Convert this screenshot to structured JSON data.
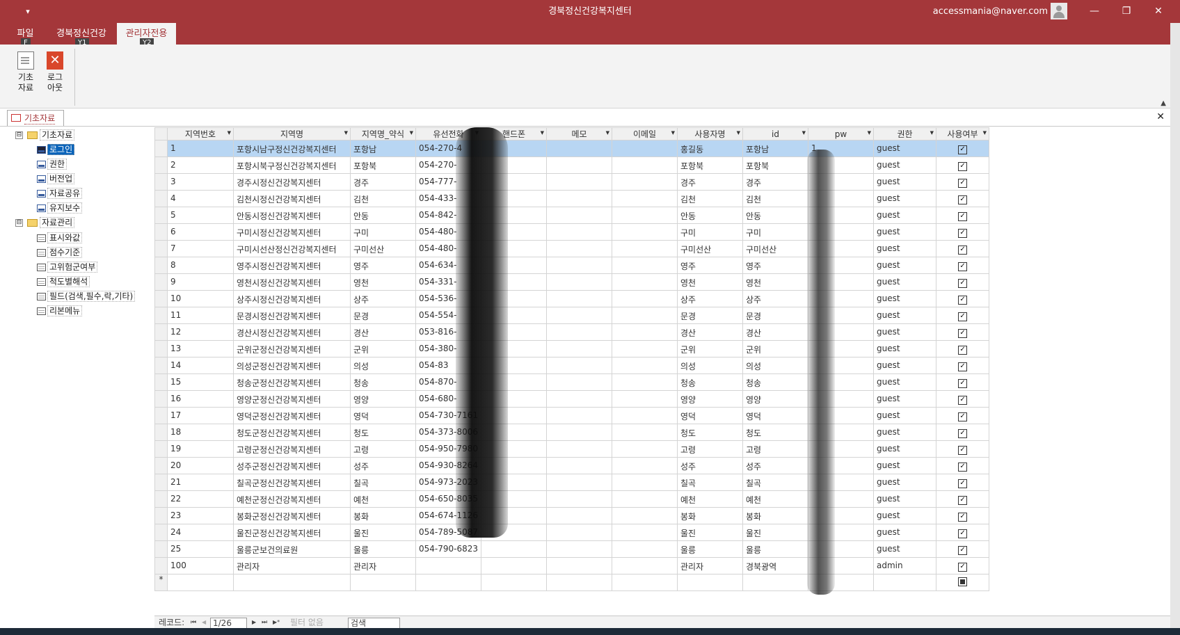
{
  "titlebar": {
    "qa_icon": "chevron-down-icon",
    "title": "경북정신건강복지센터",
    "email": "accessmania@naver.com",
    "min": "—",
    "max": "❐",
    "close": "✕"
  },
  "ribbon_tabs": [
    {
      "label": "파일",
      "keytip": "F"
    },
    {
      "label": "경북정신건강",
      "keytip": "Y1"
    },
    {
      "label": "관리자전용",
      "keytip": "Y2"
    }
  ],
  "ribbon_buttons": [
    {
      "label_line1": "기초",
      "label_line2": "자료",
      "icon": "document-icon"
    },
    {
      "label_line1": "로그",
      "label_line2": "아웃",
      "icon": "close-x-icon"
    }
  ],
  "document_tab": {
    "label": "기초자료",
    "close": "✕"
  },
  "tree": {
    "group1": {
      "label": "기초자료",
      "toggle": "⊟"
    },
    "group1_items": [
      "로그인",
      "권한",
      "버전업",
      "자료공유",
      "유지보수"
    ],
    "group2": {
      "label": "자료관리",
      "toggle": "⊟"
    },
    "group2_items": [
      "표시와값",
      "점수기준",
      "고위험군여부",
      "척도별해석",
      "필드(검색,필수,락,기타)",
      "리본메뉴"
    ]
  },
  "grid": {
    "columns": [
      "지역번호",
      "지역명",
      "지역명_약식",
      "유선전화",
      "핸드폰",
      "메모",
      "이메일",
      "사용자명",
      "id",
      "pw",
      "권한",
      "사용여부"
    ],
    "rows": [
      [
        "1",
        "포항시남구정신건강복지센터",
        "포항남",
        "054-270-4",
        "",
        "",
        "",
        "홍길동",
        "포항남",
        "1",
        "guest",
        true
      ],
      [
        "2",
        "포항시북구정신건강복지센터",
        "포항북",
        "054-270-",
        "",
        "",
        "",
        "포항북",
        "포항북",
        "",
        "guest",
        true
      ],
      [
        "3",
        "경주시정신건강복지센터",
        "경주",
        "054-777-",
        "",
        "",
        "",
        "경주",
        "경주",
        "",
        "guest",
        true
      ],
      [
        "4",
        "김천시정신건강복지센터",
        "김천",
        "054-433-",
        "",
        "",
        "",
        "김천",
        "김천",
        "",
        "guest",
        true
      ],
      [
        "5",
        "안동시정신건강복지센터",
        "안동",
        "054-842-",
        "",
        "",
        "",
        "안동",
        "안동",
        "",
        "guest",
        true
      ],
      [
        "6",
        "구미시정신건강복지센터",
        "구미",
        "054-480-",
        "",
        "",
        "",
        "구미",
        "구미",
        "",
        "guest",
        true
      ],
      [
        "7",
        "구미시선산정신건강복지센터",
        "구미선산",
        "054-480-",
        "",
        "",
        "",
        "구미선산",
        "구미선산",
        "",
        "guest",
        true
      ],
      [
        "8",
        "영주시정신건강복지센터",
        "영주",
        "054-634-",
        "",
        "",
        "",
        "영주",
        "영주",
        "",
        "guest",
        true
      ],
      [
        "9",
        "영천시정신건강복지센터",
        "영천",
        "054-331-",
        "",
        "",
        "",
        "영천",
        "영천",
        "",
        "guest",
        true
      ],
      [
        "10",
        "상주시정신건강복지센터",
        "상주",
        "054-536-",
        "",
        "",
        "",
        "상주",
        "상주",
        "",
        "guest",
        true
      ],
      [
        "11",
        "문경시정신건강복지센터",
        "문경",
        "054-554-",
        "",
        "",
        "",
        "문경",
        "문경",
        "",
        "guest",
        true
      ],
      [
        "12",
        "경산시정신건강복지센터",
        "경산",
        "053-816-",
        "",
        "",
        "",
        "경산",
        "경산",
        "",
        "guest",
        true
      ],
      [
        "13",
        "군위군정신건강복지센터",
        "군위",
        "054-380-",
        "",
        "",
        "",
        "군위",
        "군위",
        "",
        "guest",
        true
      ],
      [
        "14",
        "의성군정신건강복지센터",
        "의성",
        "054-83",
        "",
        "",
        "",
        "의성",
        "의성",
        "",
        "guest",
        true
      ],
      [
        "15",
        "청송군정신건강복지센터",
        "청송",
        "054-870-",
        "",
        "",
        "",
        "청송",
        "청송",
        "",
        "guest",
        true
      ],
      [
        "16",
        "영양군정신건강복지센터",
        "영양",
        "054-680-",
        "",
        "",
        "",
        "영양",
        "영양",
        "",
        "guest",
        true
      ],
      [
        "17",
        "영덕군정신건강복지센터",
        "영덕",
        "054-730-7161",
        "",
        "",
        "",
        "영덕",
        "영덕",
        "",
        "guest",
        true
      ],
      [
        "18",
        "청도군정신건강복지센터",
        "청도",
        "054-373-8006",
        "",
        "",
        "",
        "청도",
        "청도",
        "",
        "guest",
        true
      ],
      [
        "19",
        "고령군정신건강복지센터",
        "고령",
        "054-950-7980",
        "",
        "",
        "",
        "고령",
        "고령",
        "",
        "guest",
        true
      ],
      [
        "20",
        "성주군정신건강복지센터",
        "성주",
        "054-930-8264",
        "",
        "",
        "",
        "성주",
        "성주",
        "",
        "guest",
        true
      ],
      [
        "21",
        "칠곡군정신건강복지센터",
        "칠곡",
        "054-973-2023",
        "",
        "",
        "",
        "칠곡",
        "칠곡",
        "",
        "guest",
        true
      ],
      [
        "22",
        "예천군정신건강복지센터",
        "예천",
        "054-650-8035",
        "",
        "",
        "",
        "예천",
        "예천",
        "",
        "guest",
        true
      ],
      [
        "23",
        "봉화군정신건강복지센터",
        "봉화",
        "054-674-1126",
        "",
        "",
        "",
        "봉화",
        "봉화",
        "",
        "guest",
        true
      ],
      [
        "24",
        "울진군정신건강복지센터",
        "울진",
        "054-789-5087",
        "",
        "",
        "",
        "울진",
        "울진",
        "",
        "guest",
        true
      ],
      [
        "25",
        "울릉군보건의료원",
        "울릉",
        "054-790-6823",
        "",
        "",
        "",
        "울릉",
        "울릉",
        "",
        "guest",
        true
      ],
      [
        "100",
        "관리자",
        "관리자",
        "",
        "",
        "",
        "",
        "관리자",
        "경북광역",
        "",
        "admin",
        true
      ]
    ],
    "new_row_marker": "*"
  },
  "navbar": {
    "record_label": "레코드:",
    "first": "⏮",
    "prev": "◀",
    "position": "1/26",
    "next": "▶",
    "last": "⏭",
    "new": "▶*",
    "filter": "필터 없음",
    "search": "검색"
  },
  "colors": {
    "accent": "#a4373a",
    "selection": "#0a64ba",
    "current_row": "#b8d6f3"
  }
}
